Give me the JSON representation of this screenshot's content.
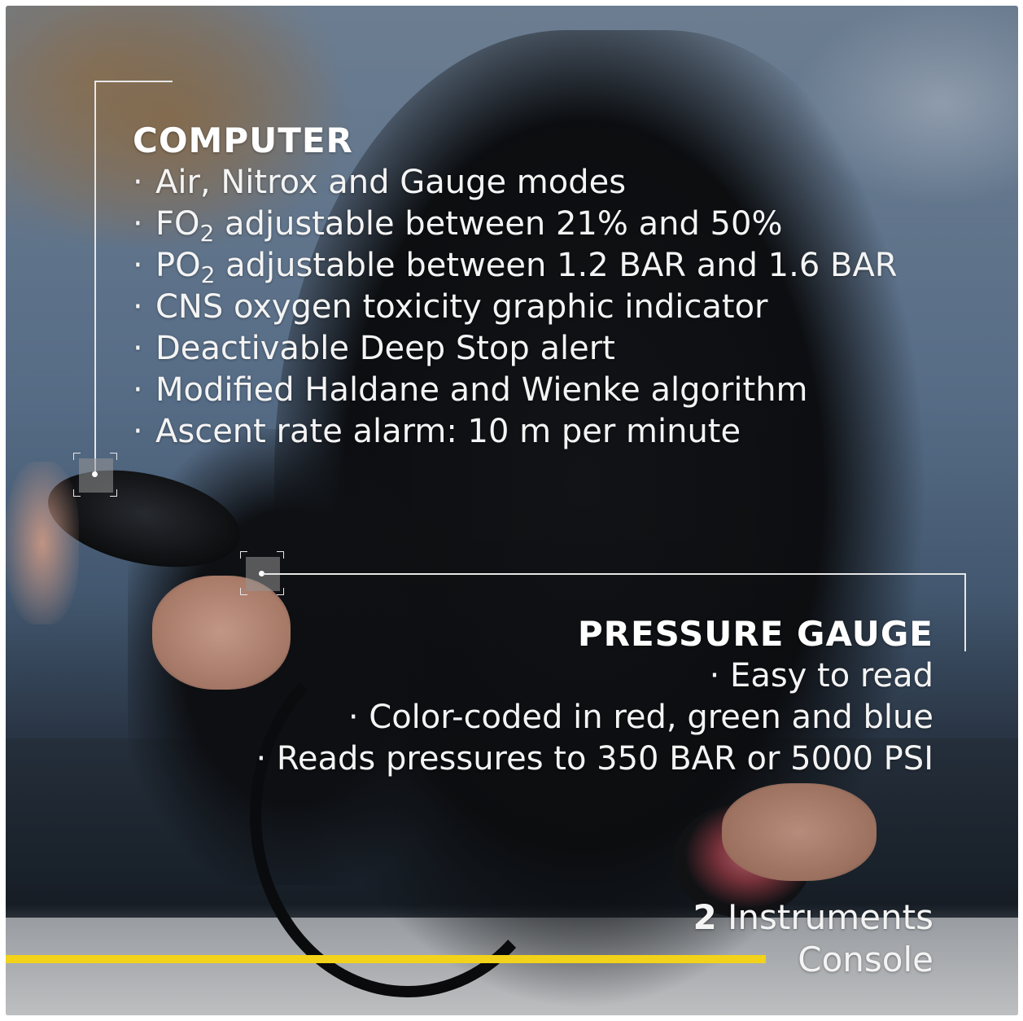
{
  "computer": {
    "title": "COMPUTER",
    "items": [
      {
        "bullet": "·",
        "text": "Air, Nitrox and Gauge modes"
      },
      {
        "bullet": "·",
        "pre": "FO",
        "sub": "2",
        "post": " adjustable between 21% and 50%"
      },
      {
        "bullet": "·",
        "pre": "PO",
        "sub": "2",
        "post": " adjustable between 1.2 BAR and 1.6 BAR"
      },
      {
        "bullet": "·",
        "text": "CNS oxygen toxicity graphic indicator"
      },
      {
        "bullet": "·",
        "text": "Deactivable Deep Stop alert"
      },
      {
        "bullet": "·",
        "text": "Modified Haldane and Wienke algorithm"
      },
      {
        "bullet": "·",
        "text": "Ascent rate alarm: 10 m per minute"
      }
    ]
  },
  "pressure_gauge": {
    "title": "PRESSURE GAUGE",
    "items": [
      "· Easy to read",
      "· Color-coded in red, green and blue",
      "· Reads pressures to 350 BAR or 5000 PSI"
    ]
  },
  "console": {
    "count": "2",
    "line1_rest": " Instruments",
    "line2": "Console"
  },
  "colors": {
    "accent_bar": "#f2d21a",
    "callout_line": "#e6e6e6",
    "text": "#f4f4f4"
  }
}
